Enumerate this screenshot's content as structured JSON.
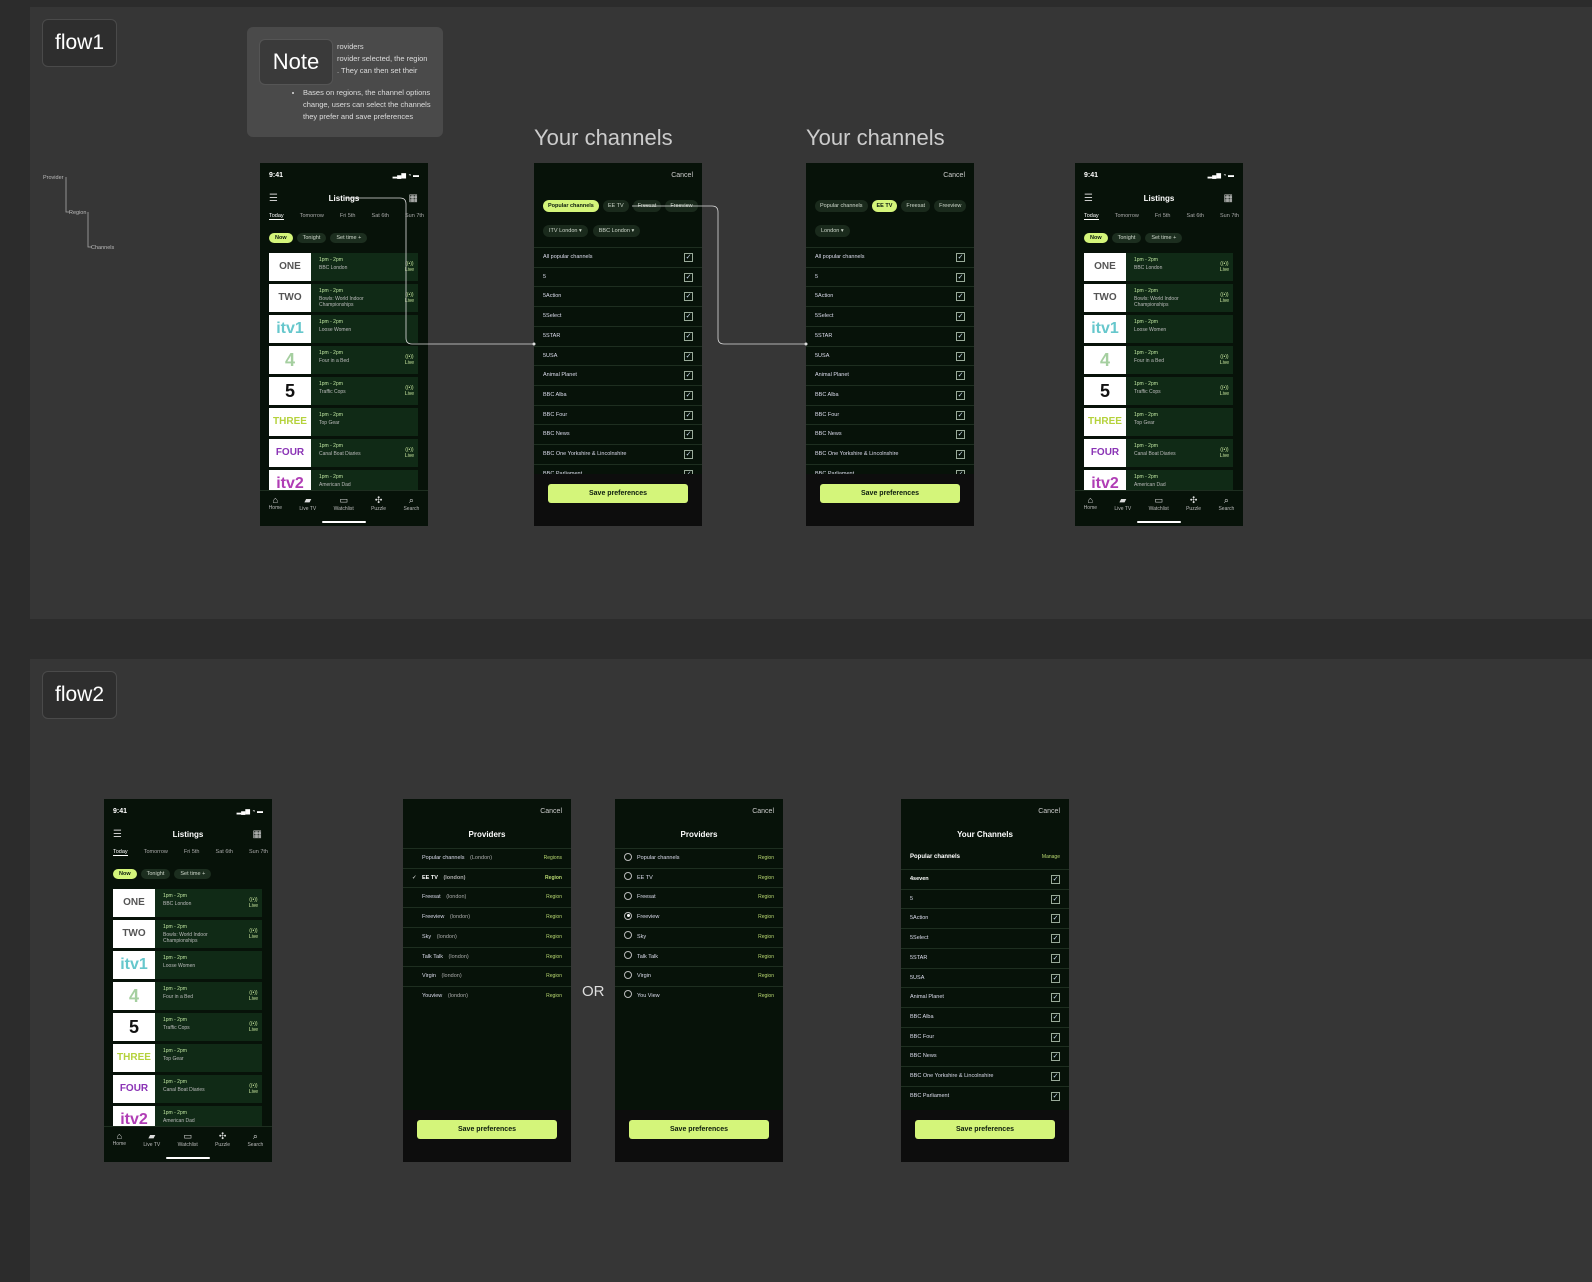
{
  "flow1": {
    "label": "flow1",
    "note": {
      "title": "Note",
      "text_lines": [
        "roviders",
        "rovider selected, the region",
        ". They can then set their"
      ],
      "bullet": "Bases on regions, the channel options change, users can select the channels they prefer and save preferences"
    },
    "tree": [
      "Provider",
      "Region",
      "Channels"
    ],
    "frame_titles": [
      "Your channels",
      "Your channels"
    ]
  },
  "flow2": {
    "label": "flow2",
    "or_label": "OR"
  },
  "listings_screen": {
    "time": "9:41",
    "title": "Listings",
    "days": [
      "Today",
      "Tomorrow",
      "Fri 5th",
      "Sat 6th",
      "Sun 7th"
    ],
    "time_chips": [
      "Now",
      "Tonight",
      "Set time  +"
    ],
    "items": [
      {
        "logo": "ONE",
        "logo_class": "one",
        "time": "1pm - 2pm",
        "show": "BBC London",
        "live": true
      },
      {
        "logo": "TWO",
        "logo_class": "two",
        "time": "1pm - 2pm",
        "show": "Bowls: World Indoor Championships",
        "live": true
      },
      {
        "logo": "itv1",
        "logo_class": "itv",
        "time": "1pm - 2pm",
        "show": "Loose Women",
        "live": false
      },
      {
        "logo": "4",
        "logo_class": "c4",
        "time": "1pm - 2pm",
        "show": "Four in a Bed",
        "live": true
      },
      {
        "logo": "5",
        "logo_class": "five",
        "time": "1pm - 2pm",
        "show": "Traffic Cops",
        "live": true
      },
      {
        "logo": "THREE",
        "logo_class": "three",
        "time": "1pm - 2pm",
        "show": "Top Gear",
        "live": false
      },
      {
        "logo": "FOUR",
        "logo_class": "four",
        "time": "1pm - 2pm",
        "show": "Canal Boat Diaries",
        "live": true
      },
      {
        "logo": "itv2",
        "logo_class": "itv2",
        "time": "1pm - 2pm",
        "show": "American Dad",
        "live": false
      }
    ],
    "live_label": "Live",
    "nav": [
      {
        "label": "Home",
        "icon": "⌂"
      },
      {
        "label": "Live TV",
        "icon": "▰"
      },
      {
        "label": "Watchlist",
        "icon": "▭"
      },
      {
        "label": "Puzzle",
        "icon": "✣"
      },
      {
        "label": "Search",
        "icon": "⌕"
      }
    ]
  },
  "channels_screen_a": {
    "cancel": "Cancel",
    "providers": [
      "Popular channels",
      "EE TV",
      "Freesat",
      "Freeview"
    ],
    "active_provider": 0,
    "regions": [
      "ITV London  ▾",
      "BBC London  ▾"
    ],
    "channels": [
      "All popular channels",
      "5",
      "5Action",
      "5Select",
      "5STAR",
      "5USA",
      "Animal Planet",
      "BBC Alba",
      "BBC Four",
      "BBC News",
      "BBC One Yorkshire & Lincolnshire",
      "BBC Parliament"
    ],
    "save": "Save preferences"
  },
  "channels_screen_b": {
    "cancel": "Cancel",
    "providers": [
      "Popular channels",
      "EE TV",
      "Freesat",
      "Freeview"
    ],
    "active_provider": 1,
    "regions": [
      "London  ▾"
    ],
    "channels": [
      "All popular channels",
      "5",
      "5Action",
      "5Select",
      "5STAR",
      "5USA",
      "Animal Planet",
      "BBC Alba",
      "BBC Four",
      "BBC News",
      "BBC One Yorkshire & Lincolnshire",
      "BBC Parliament"
    ],
    "save": "Save preferences"
  },
  "providers_screen_a": {
    "cancel": "Cancel",
    "title": "Providers",
    "rows": [
      {
        "name": "Popular channels",
        "region": "(London)",
        "link": "Regions",
        "checked": false
      },
      {
        "name": "EE TV",
        "region": "(london)",
        "link": "Region",
        "checked": true
      },
      {
        "name": "Freesat",
        "region": "(london)",
        "link": "Region",
        "checked": false
      },
      {
        "name": "Freeview",
        "region": "(london)",
        "link": "Region",
        "checked": false
      },
      {
        "name": "Sky",
        "region": "(london)",
        "link": "Region",
        "checked": false
      },
      {
        "name": "Talk Talk",
        "region": "(london)",
        "link": "Region",
        "checked": false
      },
      {
        "name": "Virgin",
        "region": "(london)",
        "link": "Region",
        "checked": false
      },
      {
        "name": "Youview",
        "region": "(london)",
        "link": "Region",
        "checked": false
      }
    ],
    "save": "Save preferences"
  },
  "providers_screen_b": {
    "cancel": "Cancel",
    "title": "Providers",
    "rows": [
      {
        "name": "Popular channels",
        "link": "Region",
        "selected": false
      },
      {
        "name": "EE TV",
        "link": "Region",
        "selected": false
      },
      {
        "name": "Freesat",
        "link": "Region",
        "selected": false
      },
      {
        "name": "Freeview",
        "link": "Region",
        "selected": true
      },
      {
        "name": "Sky",
        "link": "Region",
        "selected": false
      },
      {
        "name": "Talk Talk",
        "link": "Region",
        "selected": false
      },
      {
        "name": "Virgin",
        "link": "Region",
        "selected": false
      },
      {
        "name": "You View",
        "link": "Region",
        "selected": false
      }
    ],
    "save": "Save preferences"
  },
  "your_channels_screen": {
    "cancel": "Cancel",
    "title": "Your Channels",
    "subheader": "Popular channels",
    "manage": "Manage",
    "channels": [
      "4seven",
      "5",
      "5Action",
      "5Select",
      "5STAR",
      "5USA",
      "Animal Planet",
      "BBC Alba",
      "BBC Four",
      "BBC News",
      "BBC One Yorkshire & Lincolnshire",
      "BBC Parliament"
    ],
    "save": "Save preferences"
  },
  "colors": {
    "accent": "#d4f57a",
    "phone_bg": "#071209",
    "canvas": "#363636"
  }
}
